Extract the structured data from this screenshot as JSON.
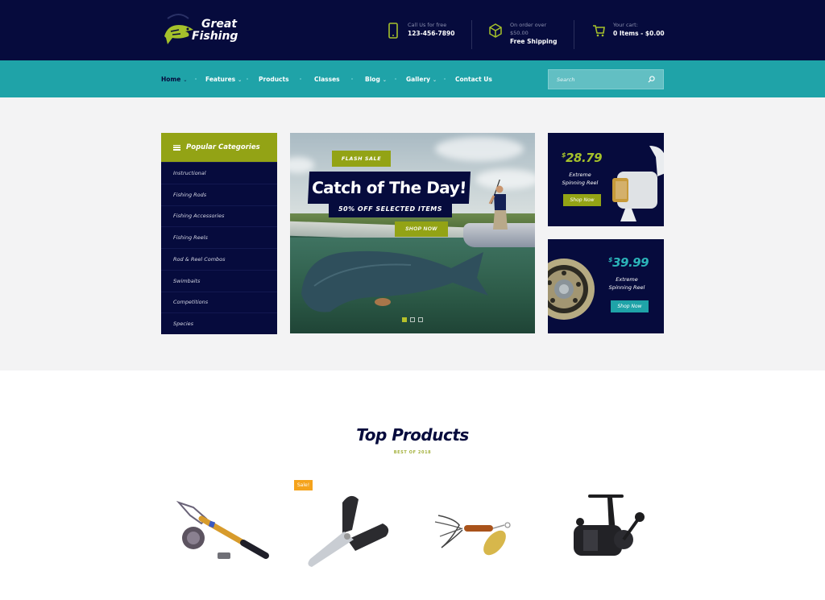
{
  "brand": {
    "line1": "Great",
    "line2": "Fishing",
    "logo_icon": "pike-fish-icon"
  },
  "header_info": [
    {
      "icon": "phone-icon",
      "small": "Call Us for free",
      "big": "123-456-7890"
    },
    {
      "icon": "box-icon",
      "small": "On order over",
      "small2": "$50.00",
      "big": "Free Shipping"
    },
    {
      "icon": "cart-icon",
      "small": "Your cart:",
      "big": "0 Items - $0.00"
    }
  ],
  "nav": {
    "items": [
      {
        "label": "Home",
        "dropdown": true,
        "active": true
      },
      {
        "label": "Features",
        "dropdown": true
      },
      {
        "label": "Products",
        "dropdown": false
      },
      {
        "label": "Classes",
        "dropdown": false
      },
      {
        "label": "Blog",
        "dropdown": true
      },
      {
        "label": "Gallery",
        "dropdown": true
      },
      {
        "label": "Contact Us",
        "dropdown": false
      }
    ],
    "caret": "⌄",
    "search_placeholder": "Search"
  },
  "categories": {
    "title": "Popular Categories",
    "items": [
      "Instructional",
      "Fishing Rods",
      "Fishing Accessories",
      "Fishing Reels",
      "Rod & Reel Combos",
      "Swimbaits",
      "Competitions",
      "Species"
    ]
  },
  "slider": {
    "badge": "FLASH SALE",
    "headline": "Catch of The Day!",
    "subline": "50% OFF SELECTED ITEMS",
    "cta": "SHOP NOW",
    "slides": 3,
    "active_slide": 1
  },
  "promos": [
    {
      "currency": "$",
      "price": "28.79",
      "name_line1": "Extreme",
      "name_line2": "Spinning Reel",
      "cta": "Shop Now",
      "accent": "#a5c12b"
    },
    {
      "currency": "$",
      "price": "39.99",
      "name_line1": "Extreme",
      "name_line2": "Spinning Reel",
      "cta": "Shop Now",
      "accent": "#2bb3b8"
    }
  ],
  "top_products": {
    "title": "Top Products",
    "subtitle": "BEST OF 2018",
    "sale_badge": "Sale!",
    "items": [
      {
        "image": "telescopic-rod-reel-image"
      },
      {
        "image": "multi-tool-pliers-image",
        "sale": true
      },
      {
        "image": "spinner-lure-image"
      },
      {
        "image": "spinning-reel-image"
      }
    ]
  },
  "colors": {
    "navy": "#060b3d",
    "teal": "#1fa3a8",
    "olive": "#93a315",
    "orange": "#f5a31c"
  }
}
